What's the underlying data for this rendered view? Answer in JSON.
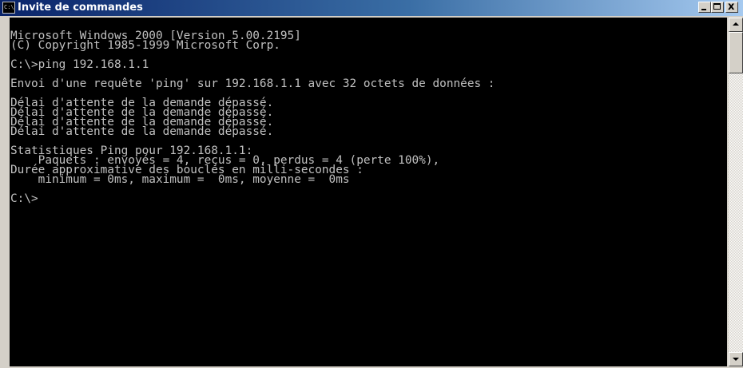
{
  "window": {
    "title": "Invite de commandes",
    "icon": "cmd-icon",
    "icon_text": "C:\\",
    "controls": {
      "minimize_icon": "minimize-icon",
      "maximize_icon": "maximize-icon",
      "close_glyph": "x"
    }
  },
  "console": {
    "lines": [
      "Microsoft Windows 2000 [Version 5.00.2195]",
      "(C) Copyright 1985-1999 Microsoft Corp.",
      "",
      "C:\\>ping 192.168.1.1",
      "",
      "Envoi d'une requête 'ping' sur 192.168.1.1 avec 32 octets de données :",
      "",
      "Délai d'attente de la demande dépassé.",
      "Délai d'attente de la demande dépassé.",
      "Délai d'attente de la demande dépassé.",
      "Délai d'attente de la demande dépassé.",
      "",
      "Statistiques Ping pour 192.168.1.1:",
      "    Paquets : envoyés = 4, reçus = 0, perdus = 4 (perte 100%),",
      "Durée approximative des boucles en milli-secondes :",
      "    minimum = 0ms, maximum =  0ms, moyenne =  0ms",
      "",
      "C:\\>"
    ]
  },
  "scrollbar": {
    "up_icon": "scroll-up-arrow-icon",
    "down_icon": "scroll-down-arrow-icon"
  },
  "colors": {
    "console_bg": "#000000",
    "console_fg": "#c0c0c0",
    "titlebar_start": "#0a246a",
    "titlebar_end": "#a6caf0"
  }
}
